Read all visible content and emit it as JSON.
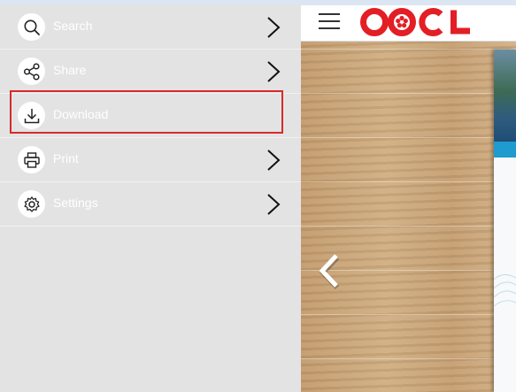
{
  "menu": {
    "items": [
      {
        "label": "Search",
        "icon": "search-icon",
        "has_chevron": true
      },
      {
        "label": "Share",
        "icon": "share-icon",
        "has_chevron": true
      },
      {
        "label": "Download",
        "icon": "download-icon",
        "has_chevron": false,
        "highlighted": true
      },
      {
        "label": "Print",
        "icon": "print-icon",
        "has_chevron": true
      },
      {
        "label": "Settings",
        "icon": "gear-icon",
        "has_chevron": true
      }
    ]
  },
  "header": {
    "logo_text": "OOCL",
    "menu_icon": "hamburger-menu-icon"
  },
  "viewer": {
    "prev_icon": "chevron-left-icon"
  },
  "colors": {
    "menu_bg": "#e3e3e3",
    "highlight": "#d62b2b",
    "logo_red": "#e31e24"
  }
}
